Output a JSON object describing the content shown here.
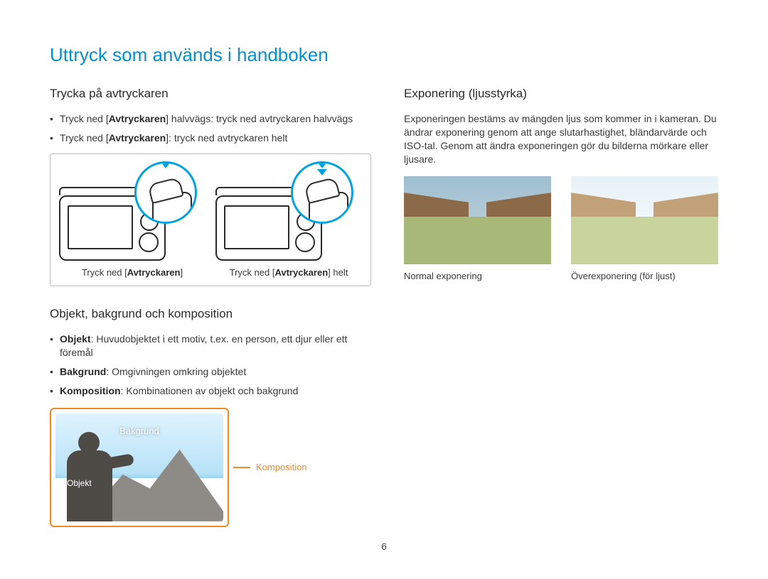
{
  "page": {
    "title": "Uttryck som används i handboken",
    "number": "6"
  },
  "left": {
    "shutter": {
      "heading": "Trycka på avtryckaren",
      "b1_pre": "Tryck ned [",
      "b1_bold": "Avtryckaren",
      "b1_post": "] halvvägs: tryck ned avtryckaren halvvägs",
      "b2_pre": "Tryck ned [",
      "b2_bold": "Avtryckaren",
      "b2_post": "]: tryck ned avtryckaren helt",
      "caption1_pre": "Tryck ned [",
      "caption1_bold": "Avtryckaren",
      "caption1_post": "]",
      "caption2_pre": "Tryck ned [",
      "caption2_bold": "Avtryckaren",
      "caption2_post": "] helt"
    },
    "composition": {
      "heading": "Objekt, bakgrund och komposition",
      "b1_bold": "Objekt",
      "b1_text": ": Huvudobjektet i ett motiv, t.ex. en person, ett djur eller ett föremål",
      "b2_bold": "Bakgrund",
      "b2_text": ": Omgivningen omkring objektet",
      "b3_bold": "Komposition",
      "b3_text": ": Kombinationen av objekt och bakgrund",
      "label_bg": "Bakgrund",
      "label_obj": "Objekt",
      "label_comp": "Komposition"
    }
  },
  "right": {
    "exposure": {
      "heading": "Exponering (ljusstyrka)",
      "paragraph": "Exponeringen bestäms av mängden ljus som kommer in i kameran. Du ändrar exponering genom att ange slutarhastighet, bländarvärde och ISO-tal. Genom att ändra exponeringen gör du bilderna mörkare eller ljusare.",
      "caption_normal": "Normal exponering",
      "caption_over": "Överexponering (för ljust)"
    }
  }
}
